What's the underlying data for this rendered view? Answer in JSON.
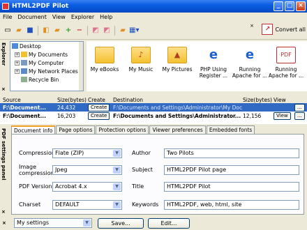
{
  "window": {
    "title": "HTML2PDF Pilot",
    "minimize": "_",
    "maximize": "□",
    "close": "×"
  },
  "menu": [
    "File",
    "Document",
    "View",
    "Explorer",
    "Help"
  ],
  "toolbar": {
    "convert_all": "Convert all",
    "close": "×"
  },
  "explorer": {
    "tab_label": "Explorer",
    "tab_close": "×",
    "tree": [
      "Desktop",
      "My Documents",
      "My Computer",
      "My Network Places",
      "Recycle Bin"
    ],
    "folders": [
      {
        "label": "My eBooks",
        "icon": "folder-icon"
      },
      {
        "label": "My Music",
        "icon": "music-folder-icon"
      },
      {
        "label": "My Pictures",
        "icon": "pictures-folder-icon"
      },
      {
        "label": "PHP Using Register ...",
        "icon": "ie-icon"
      },
      {
        "label": "Running Apache for ...",
        "icon": "ie-icon"
      },
      {
        "label": "Running Apache for ...",
        "icon": "pdf-icon"
      }
    ]
  },
  "table": {
    "headers": {
      "source": "Source",
      "size": "Size(bytes)",
      "create": "Create",
      "destination": "Destination",
      "dest_size": "Size(bytes)",
      "view": "View"
    },
    "rows": [
      {
        "source": "F:\\Document...",
        "size": "24,432",
        "create": "Create",
        "destination": "F:\\Documents and Settings\\Administrator\\My Doc...",
        "dest_size": "",
        "view": "",
        "more": "..."
      },
      {
        "source": "F:\\Document...",
        "size": "16,203",
        "create": "Create",
        "destination": "F:\\Documents and Settings\\Administrator...",
        "dest_size": "12,156",
        "view": "View",
        "more": "..."
      }
    ]
  },
  "settings": {
    "side_label": "PDF settings panel",
    "side_close": "×",
    "tabs": [
      "Document info",
      "Page options",
      "Protection options",
      "Viewer preferences",
      "Embedded fonts"
    ],
    "fields": {
      "compression": {
        "label": "Compression",
        "value": "Flate (ZIP)"
      },
      "image_compression": {
        "label": "Image compression",
        "value": "Jpeg"
      },
      "pdf_version": {
        "label": "PDF Version",
        "value": "Acrobat 4.x"
      },
      "charset": {
        "label": "Charset",
        "value": "DEFAULT"
      },
      "author": {
        "label": "Author",
        "value": "Two Pilots"
      },
      "subject": {
        "label": "Subject",
        "value": "HTML2PDF Pilot page"
      },
      "title": {
        "label": "Title",
        "value": "HTML2PDF Pilot"
      },
      "keywords": {
        "label": "Keywords",
        "value": "HTML2PDF, web, html, site"
      }
    }
  },
  "bottom": {
    "settings_select": "My settings",
    "save": "Save...",
    "edit": "Edit..."
  }
}
